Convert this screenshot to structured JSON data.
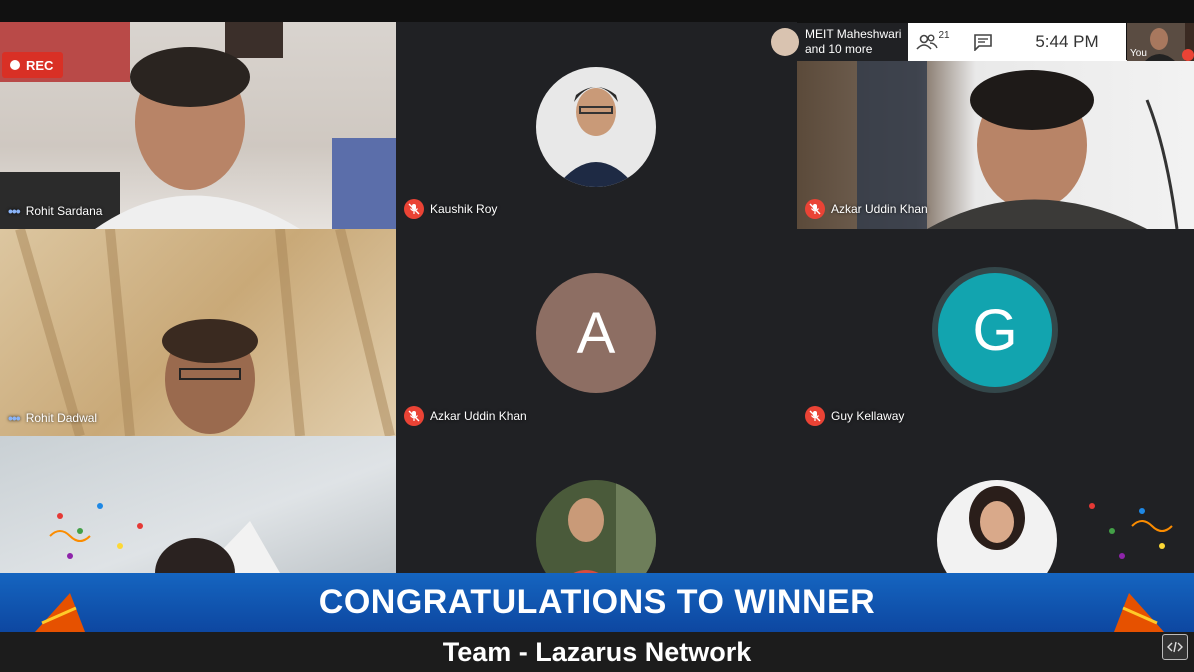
{
  "recording": {
    "label": "REC"
  },
  "header": {
    "presenter_name": "MEIT Maheshwari",
    "presenter_more": "and 10 more",
    "participant_count": "21",
    "time": "5:44 PM",
    "self_label": "You"
  },
  "tiles": [
    {
      "name": "Rohit Sardana",
      "muted": false
    },
    {
      "name": "Kaushik Roy",
      "muted": true
    },
    {
      "name": "Azkar Uddin Khan",
      "muted": true
    },
    {
      "name": "Rohit Dadwal",
      "muted": false
    },
    {
      "name": "Azkar Uddin Khan",
      "muted": true,
      "initial": "A"
    },
    {
      "name": "Guy Kellaway",
      "muted": true,
      "initial": "G"
    }
  ],
  "banner": {
    "title": "CONGRATULATIONS TO WINNER",
    "subtitle": "Team - Lazarus Network"
  },
  "colors": {
    "rec": "#d93025",
    "banner": "#1565c0",
    "muted": "#ea4335",
    "avatar_a": "#8d6e63",
    "avatar_g": "#12a4af"
  }
}
